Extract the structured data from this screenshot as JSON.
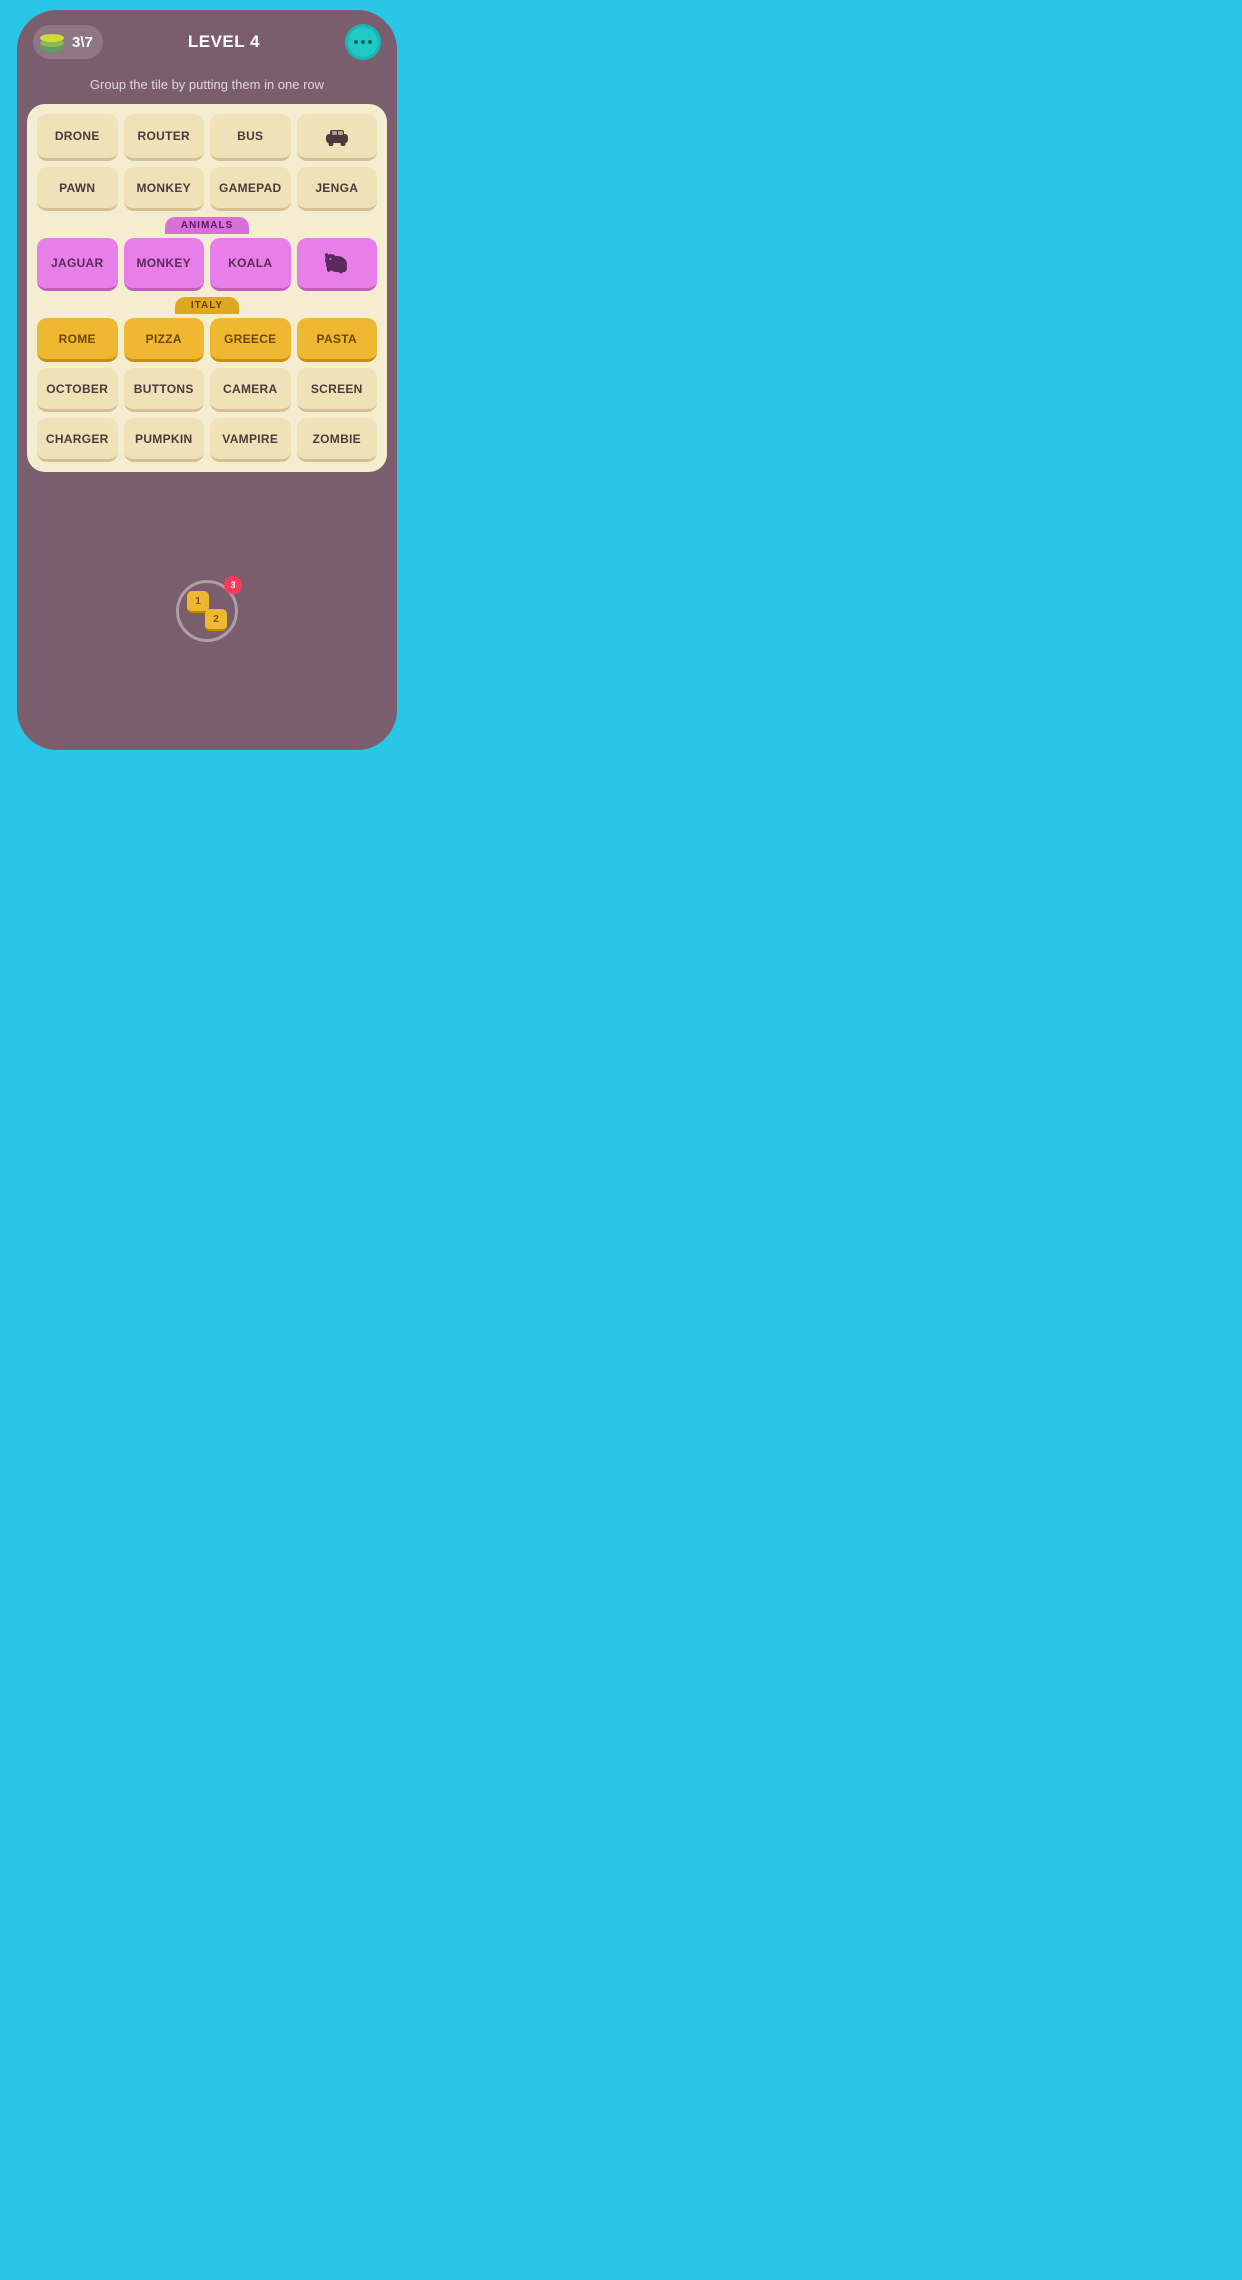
{
  "header": {
    "score": "3\\7",
    "level": "LEVEL 4",
    "menu_label": "menu"
  },
  "subtitle": "Group the tile by putting them in one row",
  "board": {
    "rows": [
      [
        {
          "label": "DRONE",
          "type": "normal"
        },
        {
          "label": "ROUTER",
          "type": "normal"
        },
        {
          "label": "BUS",
          "type": "normal"
        },
        {
          "label": "🚗",
          "type": "normal",
          "is_icon": true
        }
      ],
      [
        {
          "label": "PAWN",
          "type": "normal"
        },
        {
          "label": "MONKEY",
          "type": "normal"
        },
        {
          "label": "GAMEPAD",
          "type": "normal"
        },
        {
          "label": "JENGA",
          "type": "normal"
        }
      ]
    ],
    "animals_group": {
      "label": "ANIMALS",
      "tiles": [
        {
          "label": "JAGUAR",
          "type": "purple"
        },
        {
          "label": "MONKEY",
          "type": "purple"
        },
        {
          "label": "KOALA",
          "type": "purple"
        },
        {
          "label": "🐘",
          "type": "purple",
          "is_icon": true
        }
      ]
    },
    "italy_group": {
      "label": "ITALY",
      "tiles": [
        {
          "label": "ROME",
          "type": "gold"
        },
        {
          "label": "PIZZA",
          "type": "gold"
        },
        {
          "label": "GREECE",
          "type": "gold"
        },
        {
          "label": "PASTA",
          "type": "gold"
        }
      ]
    },
    "bottom_rows": [
      [
        {
          "label": "OCTOBER",
          "type": "normal"
        },
        {
          "label": "BUTTONS",
          "type": "normal"
        },
        {
          "label": "CAMERA",
          "type": "normal"
        },
        {
          "label": "SCREEN",
          "type": "normal"
        }
      ],
      [
        {
          "label": "CHARGER",
          "type": "normal"
        },
        {
          "label": "PUMPKIN",
          "type": "normal"
        },
        {
          "label": "VAMPIRE",
          "type": "normal"
        },
        {
          "label": "ZOMBIE",
          "type": "normal"
        }
      ]
    ]
  },
  "hint": {
    "tile1": "1",
    "tile2": "2",
    "badge": "3"
  },
  "colors": {
    "bg": "#29C6E8",
    "phone_bg": "#7B5E6E",
    "board_bg": "#F5EDD0",
    "tile_normal": "#F0E2B8",
    "tile_purple": "#E87EE8",
    "tile_gold": "#F0B830"
  }
}
